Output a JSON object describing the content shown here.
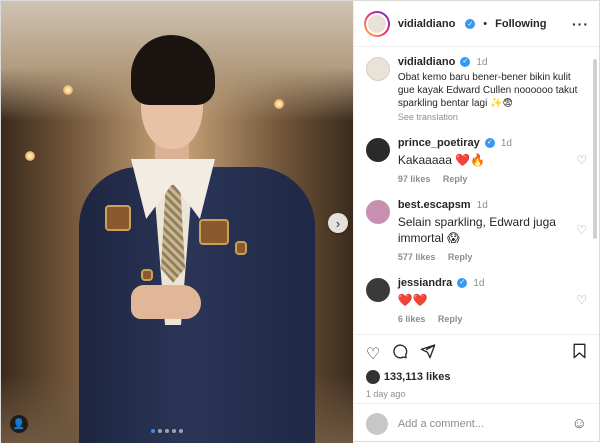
{
  "post": {
    "author": "vidialdiano",
    "follow_label": "Following",
    "separator": "•",
    "more_icon": "more-horizontal-icon"
  },
  "caption": {
    "author": "vidialdiano",
    "time": "1d",
    "text": "Obat kemo baru bener-bener bikin kulit gue kayak Edward Cullen noooooo takut sparkling bentar lagi ✨😨",
    "see_translation": "See translation"
  },
  "comments": [
    {
      "author": "prince_poetiray",
      "verified": true,
      "time": "1d",
      "text": "Kakaaaaa ❤️🔥",
      "likes": "97 likes",
      "reply": "Reply"
    },
    {
      "author": "best.escapsm",
      "verified": false,
      "time": "1d",
      "text": "Selain sparkling, Edward juga immortal 😱",
      "likes": "577 likes",
      "reply": "Reply"
    },
    {
      "author": "jessiandra",
      "verified": true,
      "time": "1d",
      "text": "❤️❤️",
      "likes": "6 likes",
      "reply": "Reply"
    }
  ],
  "actions": {
    "likes_count": "133,113 likes",
    "time_ago": "1 day ago",
    "icons": [
      "heart-icon",
      "comment-icon",
      "share-icon",
      "bookmark-icon"
    ]
  },
  "composer": {
    "placeholder": "Add a comment..."
  },
  "carousel": {
    "total": 5,
    "active": 0
  },
  "colors": {
    "verified": "#3897f0",
    "text": "#262626",
    "muted": "#8e8e8e",
    "active_dot": "#3b8cf0"
  }
}
